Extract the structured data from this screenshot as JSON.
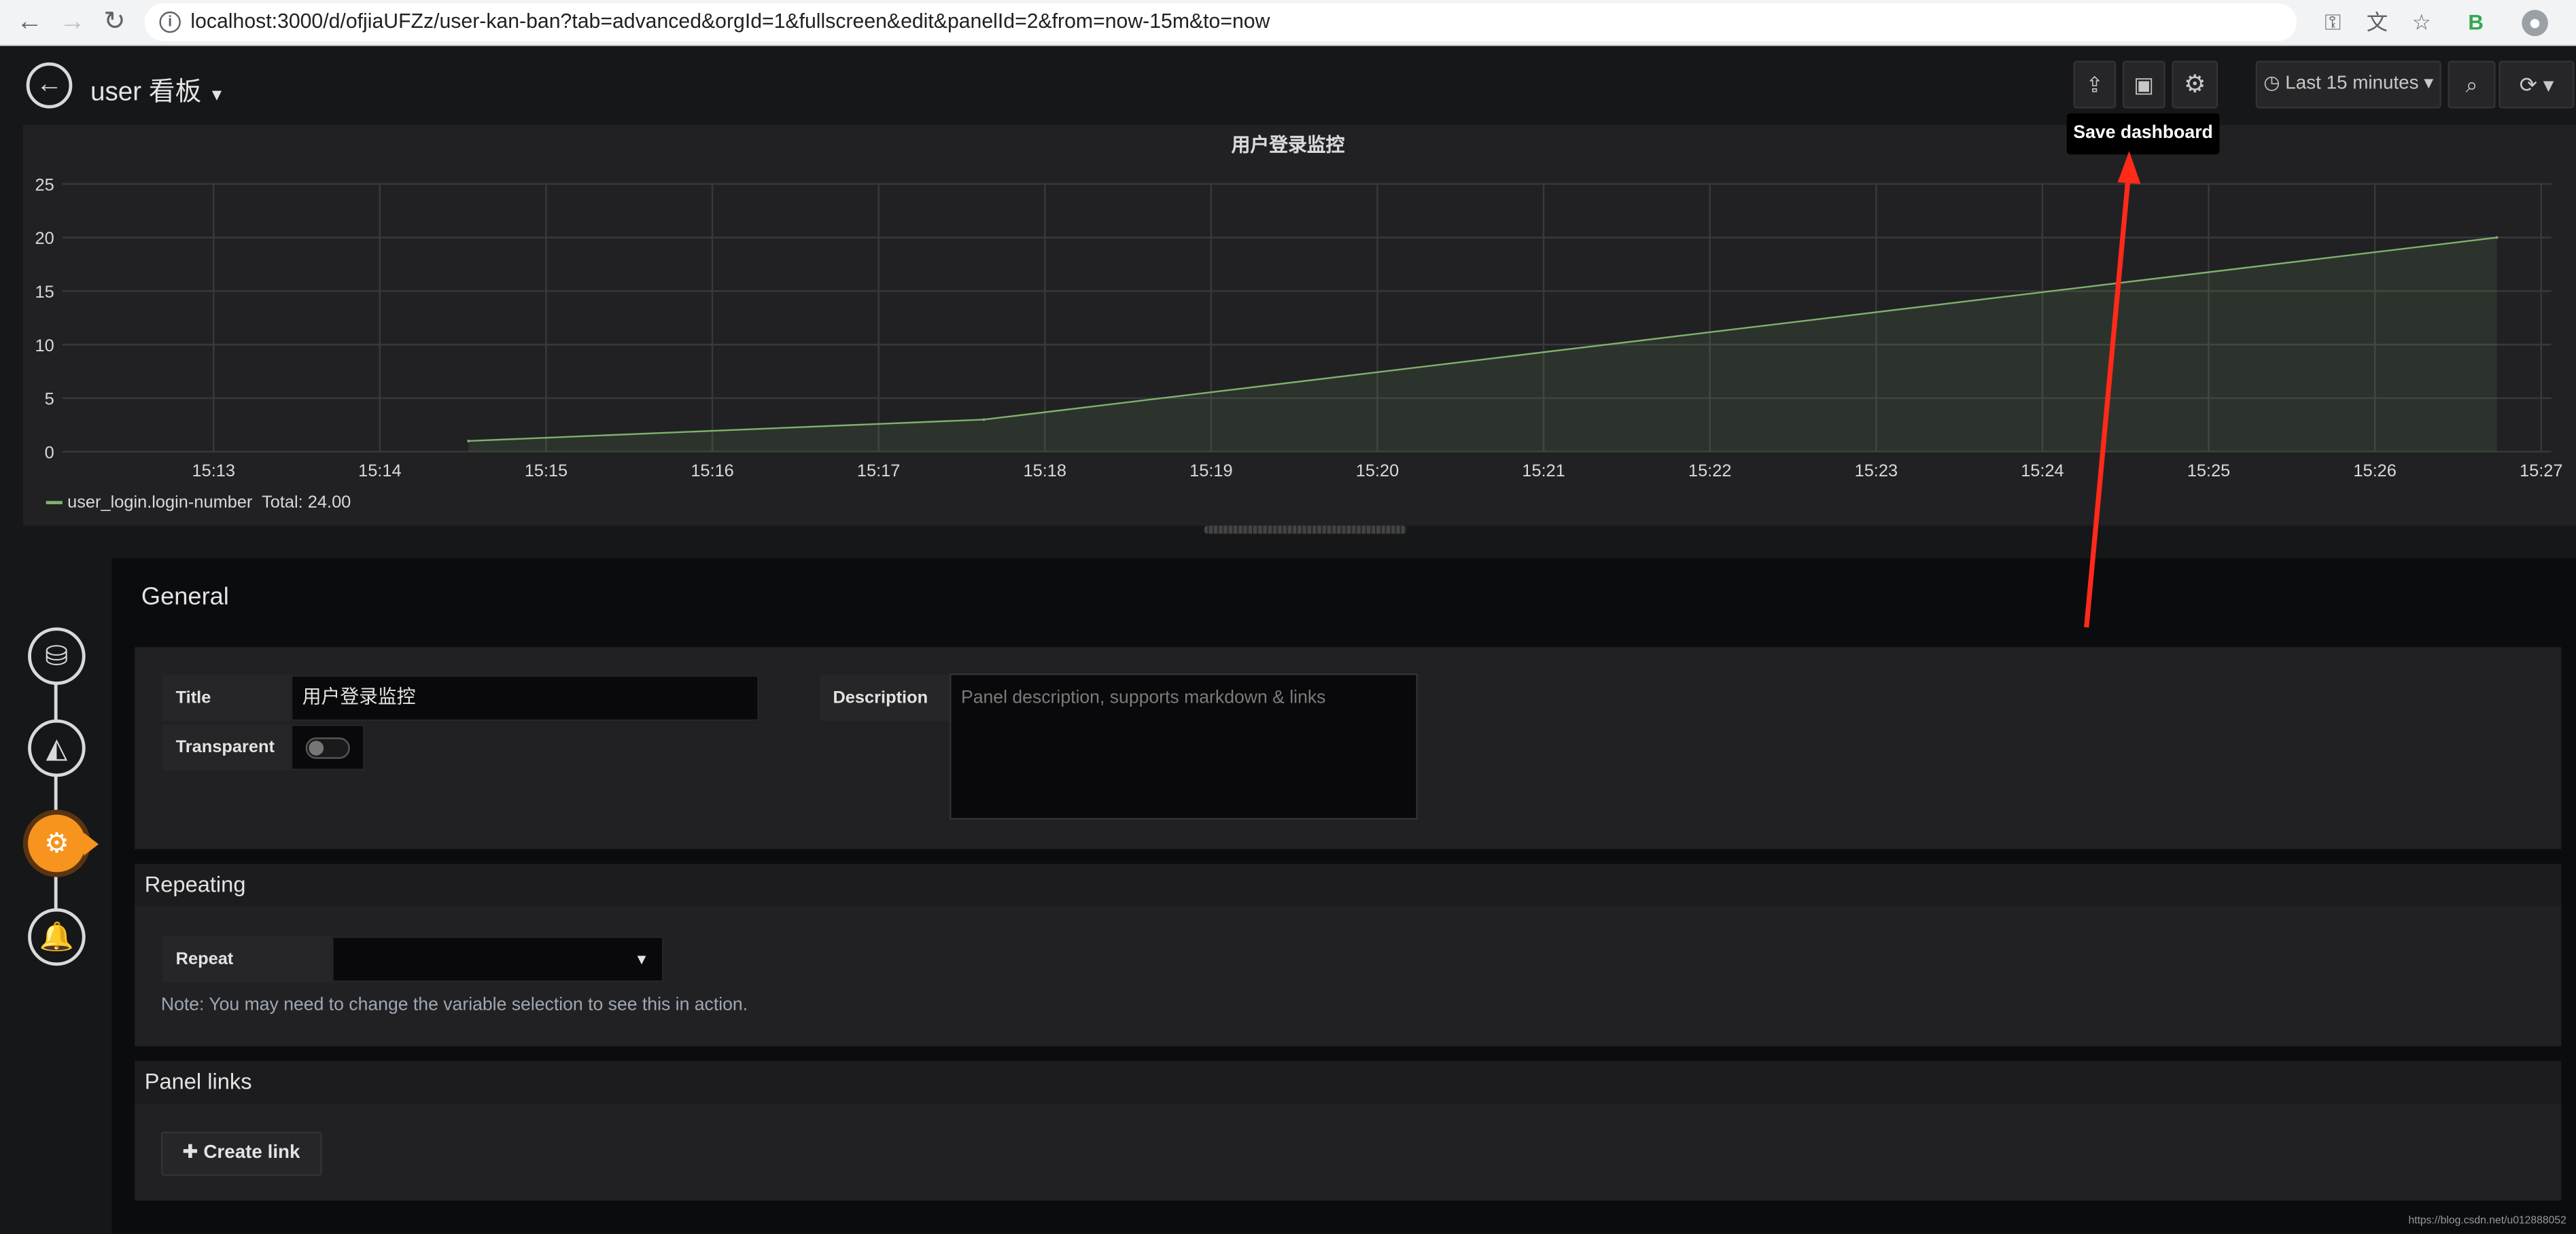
{
  "browser": {
    "url": "localhost:3000/d/ofjiaUFZz/user-kan-ban?tab=advanced&orgId=1&fullscreen&edit&panelId=2&from=now-15m&to=now"
  },
  "dashboard": {
    "title": "user 看板",
    "time_range": "Last 15 minutes",
    "tooltip": "Save dashboard"
  },
  "panel": {
    "title": "用户登录监控",
    "legend": {
      "series": "user_login.login-number",
      "total": "Total: 24.00"
    }
  },
  "chart_data": {
    "type": "area",
    "title": "用户登录监控",
    "x_ticks": [
      "15:13",
      "15:14",
      "15:15",
      "15:16",
      "15:17",
      "15:18",
      "15:19",
      "15:20",
      "15:21",
      "15:22",
      "15:23",
      "15:24",
      "15:25",
      "15:26",
      "15:27"
    ],
    "y_ticks": [
      "0",
      "5",
      "10",
      "15",
      "20",
      "25"
    ],
    "ylim": [
      0,
      25
    ],
    "series": [
      {
        "name": "user_login.login-number",
        "color": "#7eb26d",
        "x": [
          "15:14:32",
          "15:17:38",
          "15:26:44"
        ],
        "y": [
          1,
          3,
          20
        ]
      }
    ],
    "grid": true,
    "legend": "bottom-left"
  },
  "editor": {
    "general": {
      "heading": "General",
      "title_label": "Title",
      "title_value": "用户登录监控",
      "transparent_label": "Transparent",
      "description_label": "Description",
      "description_placeholder": "Panel description, supports markdown & links"
    },
    "repeating": {
      "heading": "Repeating",
      "repeat_label": "Repeat",
      "note": "Note: You may need to change the variable selection to see this in action."
    },
    "panel_links": {
      "heading": "Panel links",
      "create_link": "Create link"
    }
  },
  "wizard": {
    "steps": [
      "database-icon",
      "area-chart-icon",
      "gear-icon",
      "bell-icon"
    ],
    "active": "gear-icon"
  },
  "annotation_color": "#ff2a1a",
  "watermark": "https://blog.csdn.net/u012888052"
}
